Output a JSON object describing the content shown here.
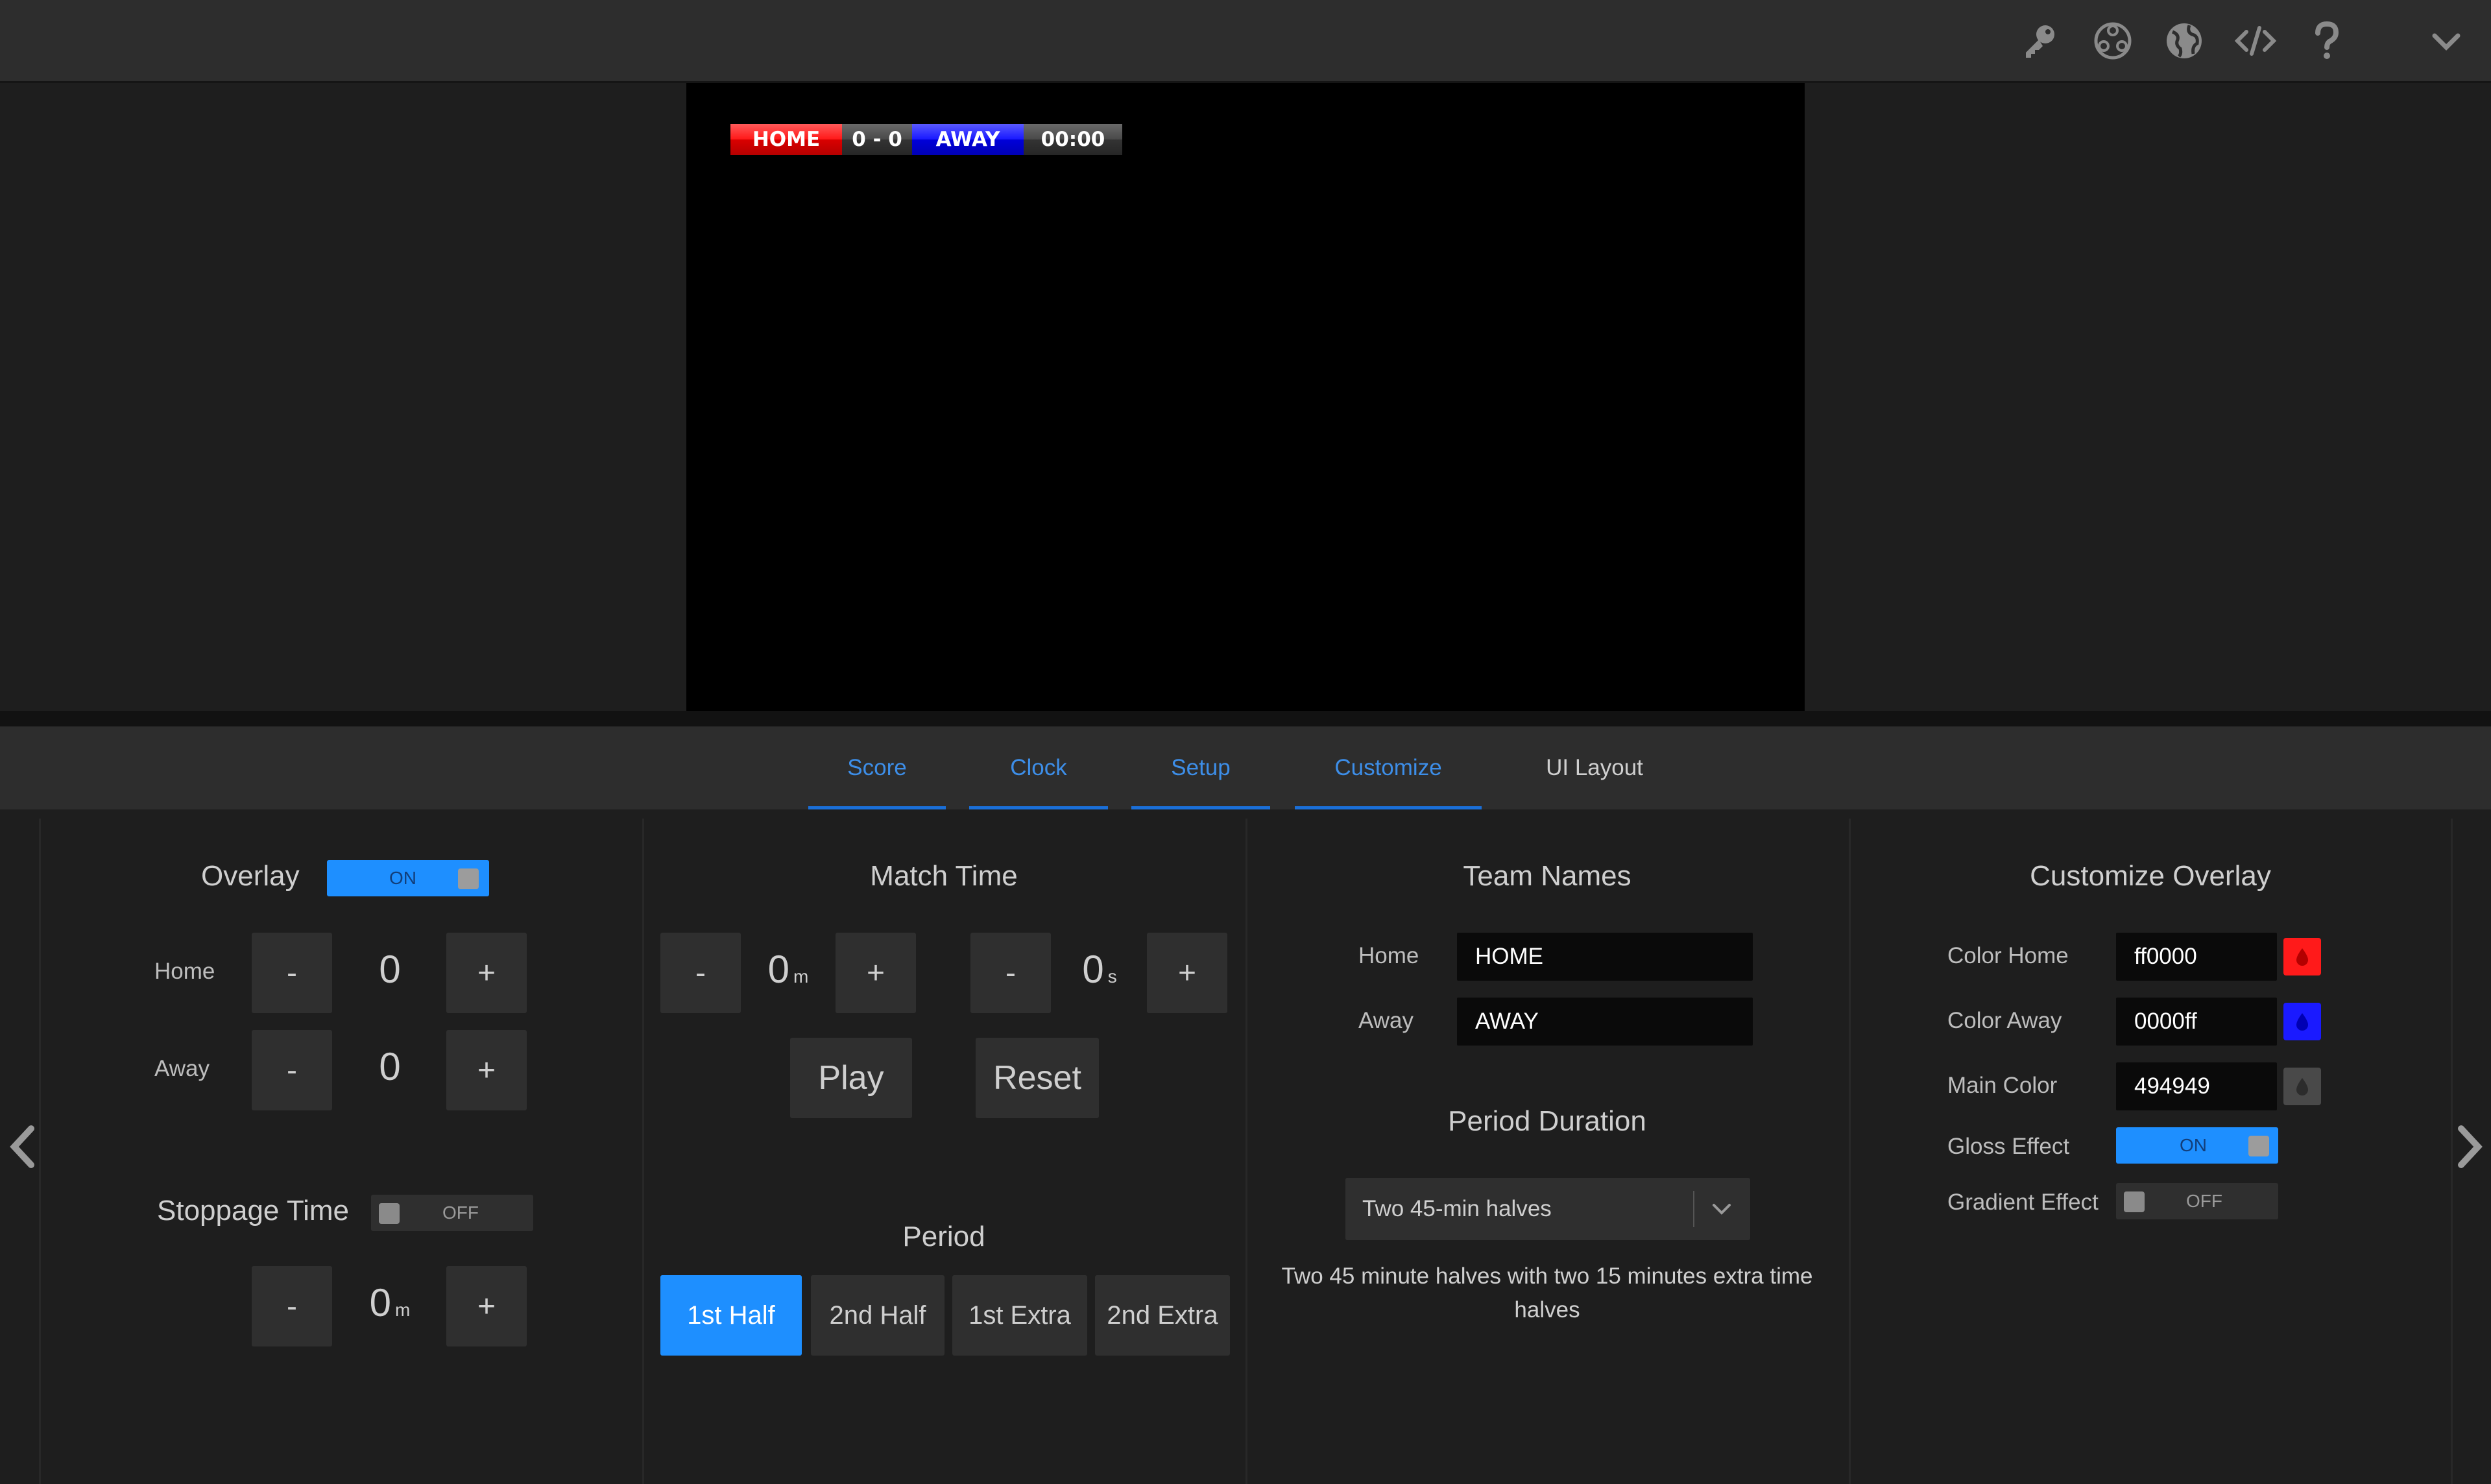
{
  "topbar": {
    "icons": [
      "key-icon",
      "obs-icon",
      "globe-icon",
      "code-icon",
      "help-icon",
      "chevron-down-icon"
    ]
  },
  "preview": {
    "home": "HOME",
    "score": "0 - 0",
    "away": "AWAY",
    "clock": "00:00"
  },
  "tabs": [
    {
      "label": "Score"
    },
    {
      "label": "Clock"
    },
    {
      "label": "Setup"
    },
    {
      "label": "Customize"
    },
    {
      "label": "UI Layout"
    }
  ],
  "score_panel": {
    "overlay_label": "Overlay",
    "overlay_toggle": "ON",
    "home_label": "Home",
    "home_value": "0",
    "away_label": "Away",
    "away_value": "0",
    "minus": "-",
    "plus": "+",
    "stoppage_label": "Stoppage Time",
    "stoppage_toggle": "OFF",
    "stoppage_value": "0",
    "stoppage_unit": "m"
  },
  "clock_panel": {
    "title": "Match Time",
    "minutes_value": "0",
    "minutes_unit": "m",
    "seconds_value": "0",
    "seconds_unit": "s",
    "minus": "-",
    "plus": "+",
    "play": "Play",
    "reset": "Reset",
    "period_title": "Period",
    "periods": [
      "1st Half",
      "2nd Half",
      "1st Extra",
      "2nd Extra"
    ]
  },
  "setup_panel": {
    "title": "Team Names",
    "home_label": "Home",
    "home_value": "HOME",
    "away_label": "Away",
    "away_value": "AWAY",
    "duration_title": "Period Duration",
    "duration_selected": "Two 45-min halves",
    "duration_desc_line1": "Two 45 minute halves with two 15 minutes extra time",
    "duration_desc_line2": "halves"
  },
  "customize_panel": {
    "title": "Customize Overlay",
    "color_home_label": "Color Home",
    "color_home_value": "ff0000",
    "color_away_label": "Color Away",
    "color_away_value": "0000ff",
    "main_color_label": "Main Color",
    "main_color_value": "494949",
    "gloss_label": "Gloss Effect",
    "gloss_toggle": "ON",
    "gradient_label": "Gradient Effect",
    "gradient_toggle": "OFF"
  },
  "colors": {
    "accent": "#1e8fff",
    "home": "#ff0000",
    "away": "#0000ff",
    "main": "#494949"
  }
}
